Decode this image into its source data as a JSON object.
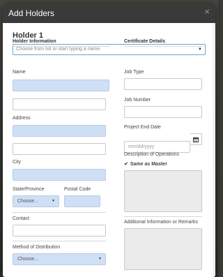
{
  "modal": {
    "title": "Add Holders",
    "close_glyph": "×"
  },
  "holder": {
    "section_title": "Holder 1",
    "select_placeholder": "Choose from list or start typing a name."
  },
  "holder_info": {
    "heading": "Holder Information",
    "name_label": "Name",
    "address_label": "Address",
    "city_label": "City",
    "state_label": "State/Province",
    "state_value": "Choose...",
    "postal_label": "Postal Code",
    "contact_label": "Contact",
    "distribution_label": "Method of Distribution",
    "distribution_value": "Choose..."
  },
  "certificate": {
    "heading": "Certificate Details",
    "job_type_label": "Job Type",
    "job_number_label": "Job Number",
    "project_end_label": "Project End Date",
    "date_placeholder": "mm/dd/yyyy",
    "description_label": "Description of Operations",
    "same_as_master_label": "Same as Master",
    "additional_label": "Additional Information or Remarks"
  },
  "icons": {
    "select_caret": "chevron-down-icon",
    "calendar": "calendar-icon",
    "check": "check-icon",
    "close": "close-icon"
  }
}
